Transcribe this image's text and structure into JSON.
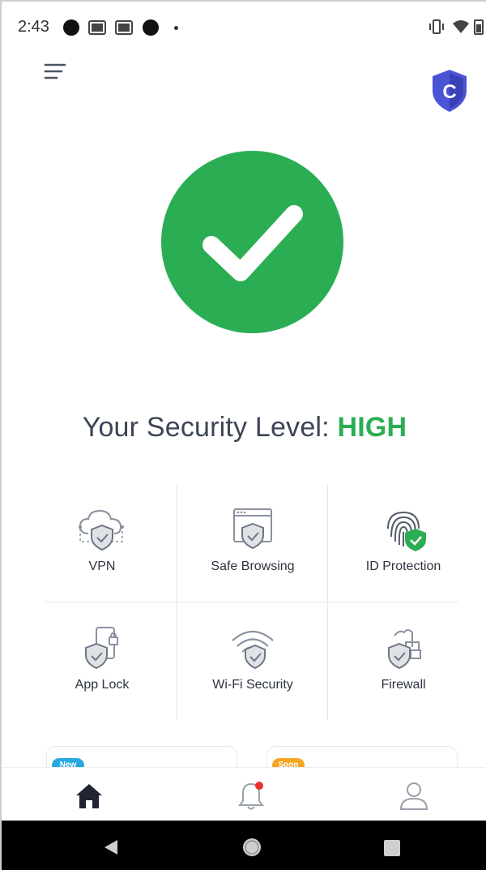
{
  "status_bar": {
    "time": "2:43"
  },
  "header": {
    "menu_icon": "hamburger-menu-icon",
    "account_badge_icon": "shield-c-icon",
    "badge_letter": "C"
  },
  "status": {
    "icon": "checkmark-icon",
    "label": "Your Security Level:",
    "level": "HIGH",
    "color": "#2bae53"
  },
  "features": [
    {
      "label": "VPN",
      "icon": "cloud-shield-icon"
    },
    {
      "label": "Safe Browsing",
      "icon": "browser-shield-icon"
    },
    {
      "label": "ID Protection",
      "icon": "fingerprint-shield-icon"
    },
    {
      "label": "App Lock",
      "icon": "phone-shield-icon"
    },
    {
      "label": "Wi-Fi Security",
      "icon": "wifi-shield-icon"
    },
    {
      "label": "Firewall",
      "icon": "brick-shield-icon"
    }
  ],
  "promos": [
    {
      "badge": "New",
      "color": "#29a9e0"
    },
    {
      "badge": "Soon",
      "color": "#f5a623"
    }
  ],
  "bottom_nav": [
    {
      "icon": "home-icon"
    },
    {
      "icon": "bell-icon"
    },
    {
      "icon": "profile-icon"
    }
  ],
  "system_nav": [
    {
      "icon": "back-icon"
    },
    {
      "icon": "home-circle-icon"
    },
    {
      "icon": "recents-icon"
    }
  ]
}
